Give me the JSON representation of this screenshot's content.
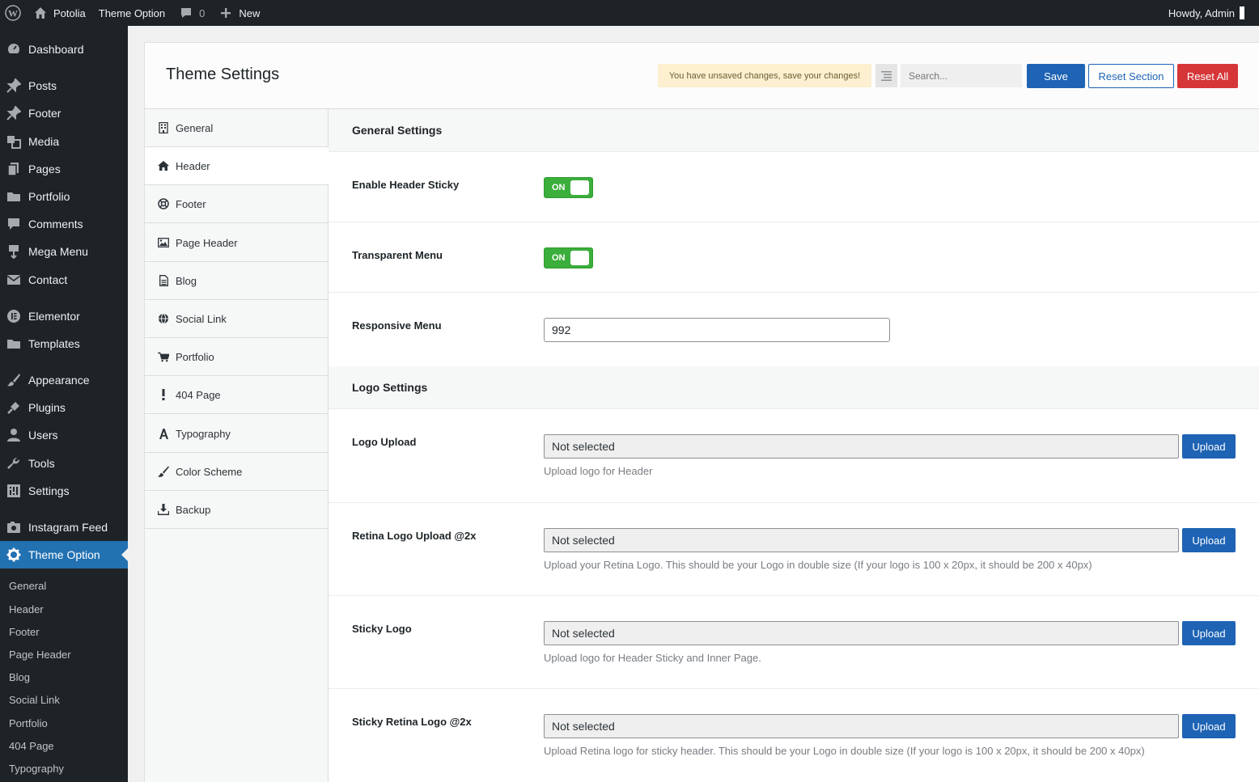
{
  "adminbar": {
    "site_name": "Potolia",
    "theme_option": "Theme Option",
    "comments_count": "0",
    "new_label": "New",
    "howdy": "Howdy, Admin"
  },
  "sidebar": {
    "items": [
      {
        "label": "Dashboard",
        "icon": "dashboard-icon"
      },
      {
        "label": "Posts",
        "icon": "pin-icon"
      },
      {
        "label": "Footer",
        "icon": "pin-icon"
      },
      {
        "label": "Media",
        "icon": "media-icon"
      },
      {
        "label": "Pages",
        "icon": "pages-icon"
      },
      {
        "label": "Portfolio",
        "icon": "folder-icon"
      },
      {
        "label": "Comments",
        "icon": "comment-icon"
      },
      {
        "label": "Mega Menu",
        "icon": "megamenu-icon"
      },
      {
        "label": "Contact",
        "icon": "mail-icon"
      },
      {
        "label": "Elementor",
        "icon": "elementor-icon"
      },
      {
        "label": "Templates",
        "icon": "folder-icon"
      },
      {
        "label": "Appearance",
        "icon": "brush-icon"
      },
      {
        "label": "Plugins",
        "icon": "plug-icon"
      },
      {
        "label": "Users",
        "icon": "user-icon"
      },
      {
        "label": "Tools",
        "icon": "wrench-icon"
      },
      {
        "label": "Settings",
        "icon": "sliders-icon"
      },
      {
        "label": "Instagram Feed",
        "icon": "camera-icon"
      },
      {
        "label": "Theme Option",
        "icon": "gear-icon"
      }
    ],
    "submenu": [
      "General",
      "Header",
      "Footer",
      "Page Header",
      "Blog",
      "Social Link",
      "Portfolio",
      "404 Page",
      "Typography"
    ]
  },
  "panel": {
    "title": "Theme Settings",
    "notice": "You have unsaved changes, save your changes!",
    "search_placeholder": "Search...",
    "save_label": "Save",
    "reset_section_label": "Reset Section",
    "reset_all_label": "Reset All"
  },
  "tabs": [
    {
      "label": "General",
      "icon": "building-icon"
    },
    {
      "label": "Header",
      "icon": "home-icon"
    },
    {
      "label": "Footer",
      "icon": "lifebuoy-icon"
    },
    {
      "label": "Page Header",
      "icon": "image-icon"
    },
    {
      "label": "Blog",
      "icon": "document-icon"
    },
    {
      "label": "Social Link",
      "icon": "globe-icon"
    },
    {
      "label": "Portfolio",
      "icon": "cart-icon"
    },
    {
      "label": "404 Page",
      "icon": "exclamation-icon"
    },
    {
      "label": "Typography",
      "icon": "font-icon"
    },
    {
      "label": "Color Scheme",
      "icon": "brush-icon"
    },
    {
      "label": "Backup",
      "icon": "download-icon"
    }
  ],
  "content": {
    "general_heading": "General Settings",
    "enable_sticky_label": "Enable Header Sticky",
    "transparent_menu_label": "Transparent Menu",
    "toggle_on": "ON",
    "responsive_menu_label": "Responsive Menu",
    "responsive_menu_value": "992",
    "logo_heading": "Logo Settings",
    "upload_label": "Upload",
    "not_selected": "Not selected",
    "logo_upload": {
      "label": "Logo Upload",
      "desc": "Upload logo for Header"
    },
    "retina_logo": {
      "label": "Retina Logo Upload @2x",
      "desc": "Upload your Retina Logo. This should be your Logo in double size (If your logo is 100 x 20px, it should be 200 x 40px)"
    },
    "sticky_logo": {
      "label": "Sticky Logo",
      "desc": "Upload logo for Header Sticky and Inner Page."
    },
    "sticky_retina_logo": {
      "label": "Sticky Retina Logo @2x",
      "desc": "Upload Retina logo for sticky header. This should be your Logo in double size (If your logo is 100 x 20px, it should be 200 x 40px)"
    }
  },
  "colors": {
    "admin_dark": "#1d2327",
    "accent_blue": "#2271b1",
    "button_blue": "#1e63b4",
    "danger_red": "#d63638",
    "toggle_green": "#3bae3b",
    "notice_bg": "#fcf0d0"
  }
}
